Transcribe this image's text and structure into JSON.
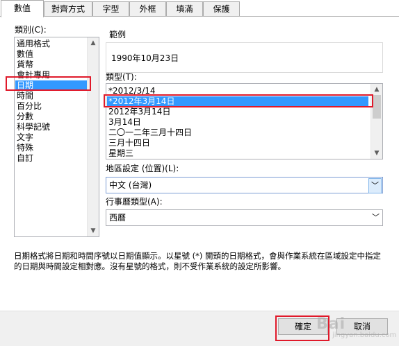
{
  "tabs": [
    {
      "label": "數值"
    },
    {
      "label": "對齊方式"
    },
    {
      "label": "字型"
    },
    {
      "label": "外框"
    },
    {
      "label": "填滿"
    },
    {
      "label": "保護"
    }
  ],
  "category": {
    "label": "類別(C):",
    "items": [
      "通用格式",
      "數值",
      "貨幣",
      "會計專用",
      "日期",
      "時間",
      "百分比",
      "分數",
      "科學記號",
      "文字",
      "特殊",
      "自訂"
    ],
    "selected": "日期"
  },
  "sample": {
    "label": "範例",
    "value": "1990年10月23日"
  },
  "type": {
    "label": "類型(T):",
    "items": [
      "*2012/3/14",
      "*2012年3月14日",
      "2012年3月14日",
      "3月14日",
      "二〇一二年三月十四日",
      "三月十四日",
      "星期三"
    ],
    "selected": "*2012年3月14日"
  },
  "locale": {
    "label": "地區設定 (位置)(L):",
    "value": "中文 (台灣)"
  },
  "calendar": {
    "label": "行事曆類型(A):",
    "value": "西曆"
  },
  "description": "日期格式將日期和時間序號以日期值顯示。以星號 (*) 開頭的日期格式，會與作業系統在區域設定中指定的日期與時間設定相對應。沒有星號的格式，則不受作業系統的設定所影響。",
  "buttons": {
    "ok": "確定",
    "cancel": "取消"
  },
  "watermark": {
    "brand": "Bai",
    "sub": "jingyan.baidu.com"
  },
  "colors": {
    "selection": "#3399ff",
    "highlight": "#e0192a"
  }
}
